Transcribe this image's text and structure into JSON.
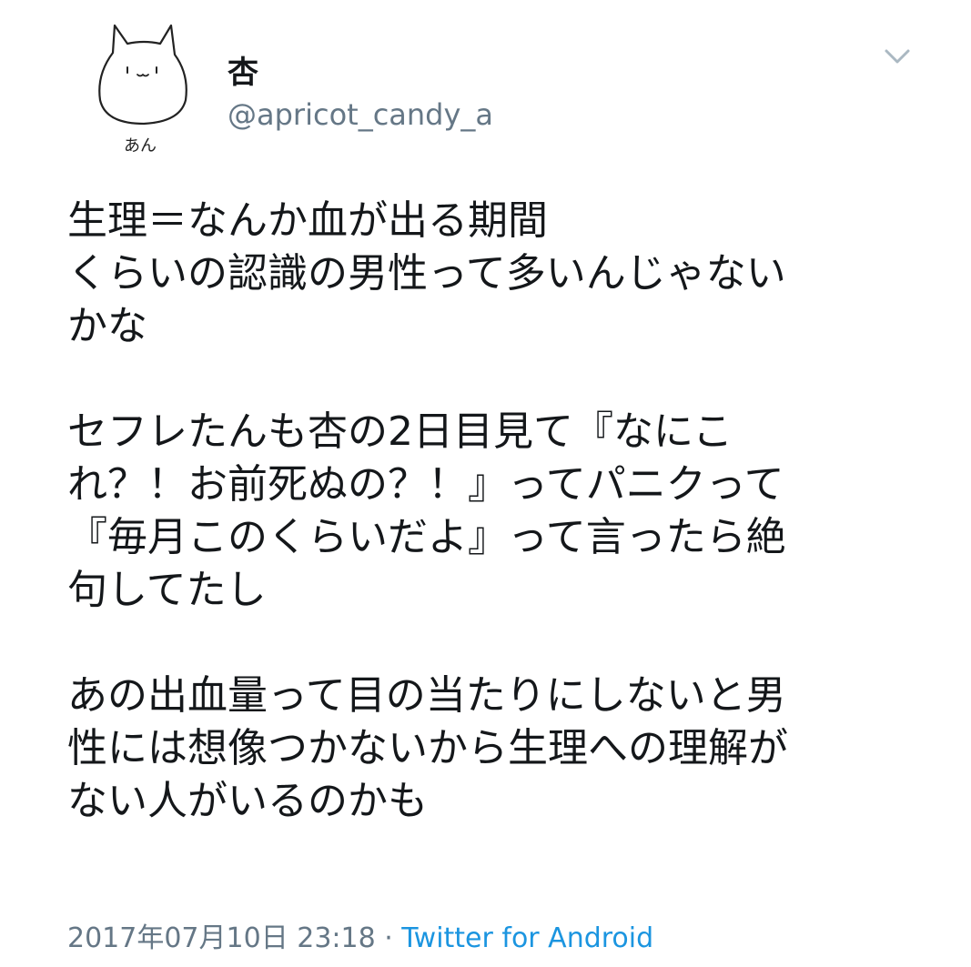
{
  "author": {
    "avatar_caption": "あん",
    "name": "杏",
    "handle": "@apricot_candy_a"
  },
  "more_menu": {
    "icon": "chevron-down-icon"
  },
  "tweet": {
    "paragraphs": [
      {
        "lines": [
          "生理＝なんか血が出る期間",
          "くらいの認識の男性って多いんじゃない",
          "かな"
        ]
      },
      {
        "lines": [
          "セフレたんも杏の2日目見て『なにこ",
          "れ？！お前死ぬの？！』ってパニクって",
          "『毎月このくらいだよ』って言ったら絶",
          "句してたし"
        ]
      },
      {
        "lines": [
          "あの出血量って目の当たりにしないと男",
          "性には想像つかないから生理への理解が",
          "ない人がいるのかも"
        ]
      }
    ]
  },
  "meta": {
    "timestamp": "2017年07月10日 23:18",
    "separator": " · ",
    "source": "Twitter for Android"
  },
  "colors": {
    "text": "#14171a",
    "secondary": "#657786",
    "link": "#1b95e0",
    "caret": "#aab8c2"
  }
}
